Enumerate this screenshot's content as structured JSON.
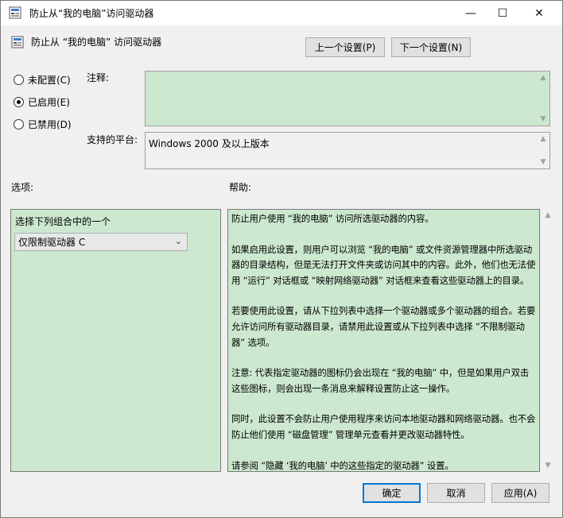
{
  "window": {
    "title": "防止从“我的电脑”访问驱动器",
    "minimize_glyph": "—",
    "maximize_glyph": "☐",
    "close_glyph": "✕"
  },
  "header": {
    "title": "防止从 “我的电脑” 访问驱动器",
    "prev_label": "上一个设置(P)",
    "next_label": "下一个设置(N)"
  },
  "state": {
    "options": [
      {
        "label": "未配置(C)",
        "checked": false
      },
      {
        "label": "已启用(E)",
        "checked": true
      },
      {
        "label": "已禁用(D)",
        "checked": false
      }
    ]
  },
  "comment": {
    "label": "注释:",
    "value": ""
  },
  "platform": {
    "label": "支持的平台:",
    "value": "Windows 2000 及以上版本"
  },
  "options_section": {
    "label": "选项:",
    "select_label": "选择下列组合中的一个",
    "selected": "仅限制驱动器 C"
  },
  "help_section": {
    "label": "帮助:",
    "paragraphs": [
      "防止用户使用 “我的电脑” 访问所选驱动器的内容。",
      "如果启用此设置，则用户可以浏览 “我的电脑” 或文件资源管理器中所选驱动器的目录结构，但是无法打开文件夹或访问其中的内容。此外，他们也无法使用 “运行” 对话框或 “映射网络驱动器” 对话框来查看这些驱动器上的目录。",
      "若要使用此设置，请从下拉列表中选择一个驱动器或多个驱动器的组合。若要允许访问所有驱动器目录，请禁用此设置或从下拉列表中选择 “不限制驱动器” 选项。",
      "注意: 代表指定驱动器的图标仍会出现在 “我的电脑” 中，但是如果用户双击这些图标，则会出现一条消息来解释设置防止这一操作。",
      " 同时，此设置不会防止用户使用程序来访问本地驱动器和网络驱动器。也不会防止他们使用 “磁盘管理” 管理单元查看并更改驱动器特性。",
      "请参阅 “隐藏 ‘我的电脑’ 中的这些指定的驱动器” 设置。"
    ]
  },
  "footer": {
    "ok_label": "确定",
    "cancel_label": "取消",
    "apply_label": "应用(A)"
  },
  "colors": {
    "panel_green": "#cce8cf",
    "default_button_border": "#0078d7"
  },
  "icons": [
    "policy-app-icon",
    "policy-setting-icon",
    "chevron-down-icon",
    "scroll-up-icon",
    "scroll-down-icon"
  ]
}
